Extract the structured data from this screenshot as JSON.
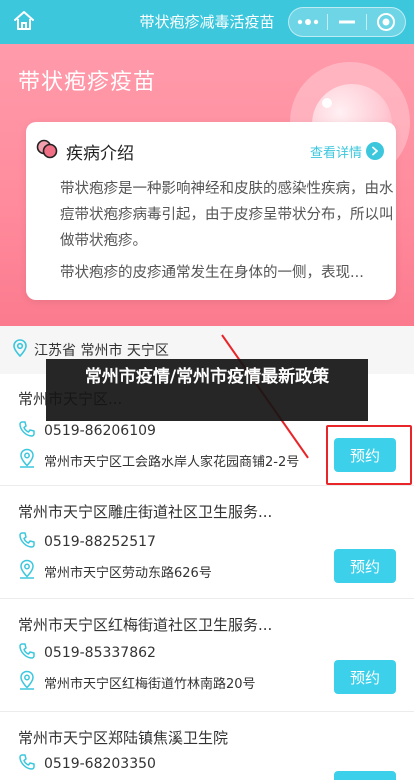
{
  "header": {
    "title": "带状疱疹减毒活疫苗",
    "icons": [
      "home-icon",
      "more-dots-icon",
      "minimize-icon",
      "close-circle-icon"
    ]
  },
  "hero": {
    "title": "带状疱疹疫苗"
  },
  "intro": {
    "title": "疾病介绍",
    "more_label": "查看详情",
    "paragraph1": "带状疱疹是一种影响神经和皮肤的感染性疾病，由水痘带状疱疹病毒引起，由于皮疹呈带状分布，所以叫做带状疱疹。",
    "paragraph2": "带状疱疹的皮疹通常发生在身体的一侧，表现..."
  },
  "location": {
    "text": "江苏省 常州市 天宁区"
  },
  "clinics": [
    {
      "name": "常州市天宁区...",
      "phone": "0519-86206109",
      "address": "常州市天宁区工会路水岸人家花园商铺2-2号",
      "button": "预约"
    },
    {
      "name": "常州市天宁区雕庄街道社区卫生服务...",
      "phone": "0519-88252517",
      "address": "常州市天宁区劳动东路626号",
      "button": "预约"
    },
    {
      "name": "常州市天宁区红梅街道社区卫生服务...",
      "phone": "0519-85337862",
      "address": "常州市天宁区红梅街道竹林南路20号",
      "button": "预约"
    },
    {
      "name": "常州市天宁区郑陆镇焦溪卫生院",
      "phone": "0519-68203350",
      "address": "",
      "button": "预约"
    }
  ],
  "banner": {
    "text": "常州市疫情/常州市疫情最新政策"
  },
  "colors": {
    "accent": "#3cc7dd",
    "button": "#3cd0ea",
    "hero": "#ff8a9b",
    "highlight": "#e8262a"
  }
}
